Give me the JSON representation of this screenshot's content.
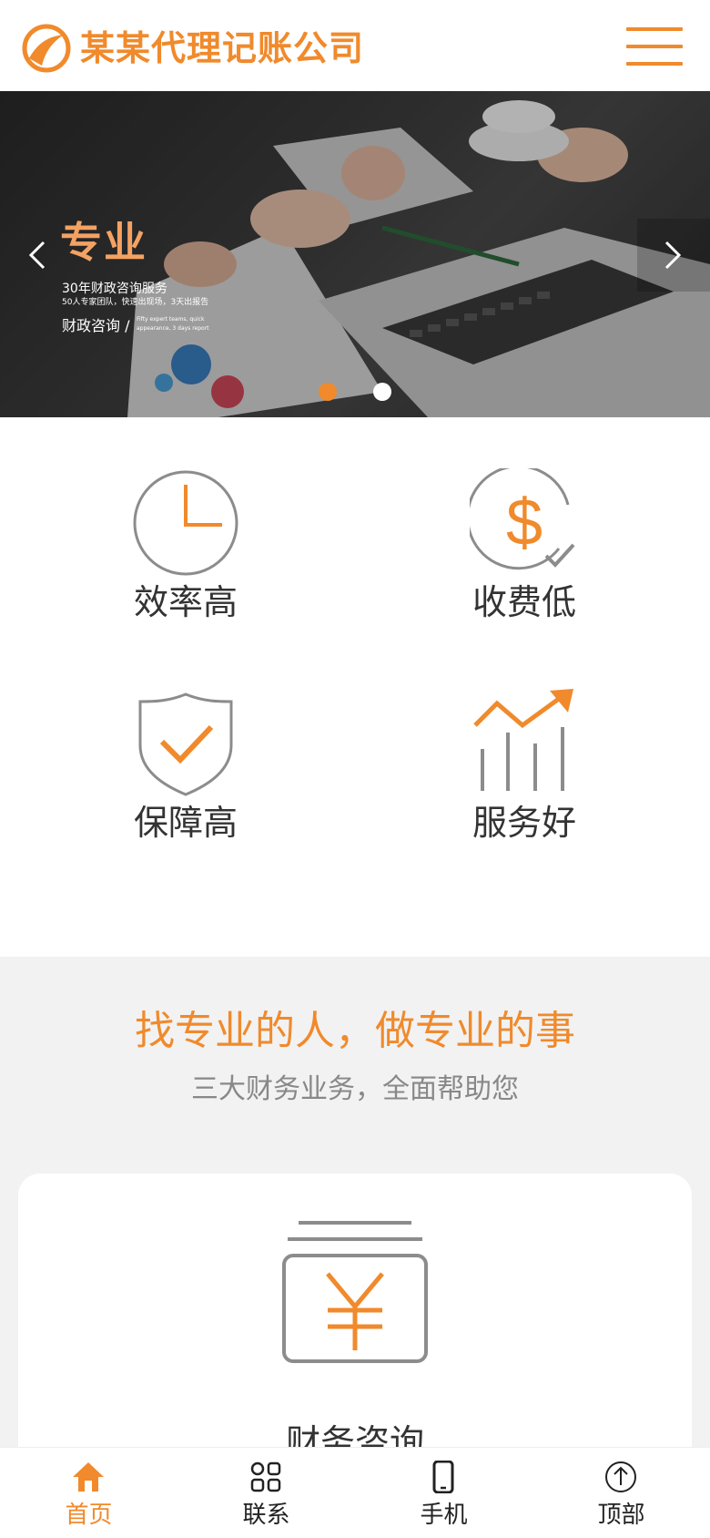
{
  "header": {
    "company_name": "某某代理记账公司",
    "accent_color": "#f08a2c"
  },
  "banner": {
    "title": "专业",
    "line1": "30年财政咨询服务",
    "line2": "50人专家团队，快速出现场，3天出报告",
    "line3": "财政咨询 /",
    "line3_en": "Fifty expert teams, quick appearance, 3 days report",
    "active_slide": 1,
    "slide_count": 2
  },
  "features": [
    {
      "icon": "clock-icon",
      "label": "效率高"
    },
    {
      "icon": "dollar-check-icon",
      "label": "收费低"
    },
    {
      "icon": "shield-check-icon",
      "label": "保障高"
    },
    {
      "icon": "growth-chart-icon",
      "label": "服务好"
    }
  ],
  "section": {
    "title": "找专业的人，做专业的事",
    "subtitle": "三大财务业务，全面帮助您",
    "card": {
      "icon": "yen-box-icon",
      "label": "财务咨询"
    }
  },
  "bottom_nav": [
    {
      "icon": "home-icon",
      "label": "首页",
      "active": true
    },
    {
      "icon": "grid-icon",
      "label": "联系",
      "active": false
    },
    {
      "icon": "phone-icon",
      "label": "手机",
      "active": false
    },
    {
      "icon": "arrow-up-circle-icon",
      "label": "顶部",
      "active": false
    }
  ]
}
